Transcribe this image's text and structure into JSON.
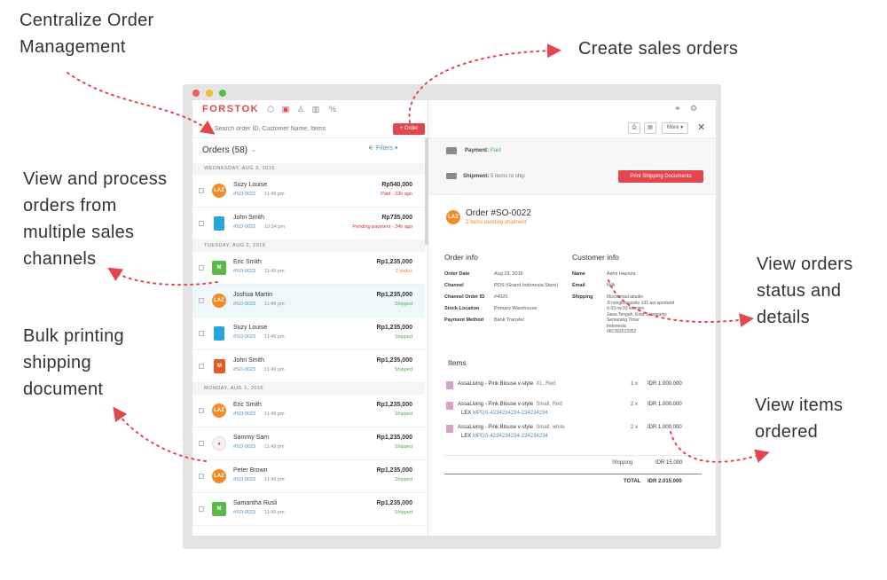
{
  "callouts": {
    "centralize": "Centralize Order\nManagement",
    "create": "Create sales orders",
    "view_process": "View and process\norders from\nmultiple sales\nchannels",
    "bulk": "Bulk printing\nshipping\ndocument",
    "status": "View orders\nstatus and\ndetails",
    "items": "View items\nordered"
  },
  "colors": {
    "accent": "#e0484e",
    "link": "#4a90c2",
    "paid": "#4caf50",
    "pending": "#d32f2f",
    "status_orange": "#f28a26"
  },
  "app": {
    "logo": "FORSTOK",
    "nav_icons": [
      "box-icon",
      "shopping-bag-icon",
      "user-icon",
      "bar-chart-icon",
      "discount-icon"
    ],
    "search_placeholder": "Search order ID, Customer Name, Items",
    "order_button": "+ Order",
    "orders_title": "Orders (58)",
    "filters": "Filters"
  },
  "groups": [
    {
      "date": "WEDNESDAY, AUG 3, 2016",
      "orders": [
        {
          "channel": "laz",
          "channel_label": "LAZ",
          "name": "Suzy Louise",
          "id": "#SO-0022",
          "time": "11:49 pm",
          "amount": "Rp540,000",
          "status": "Paid - 23h ago",
          "status_color": "#d32f2f"
        },
        {
          "channel": "bag",
          "channel_label": "",
          "name": "John Smith",
          "id": "#SO-0022",
          "time": "10:34 pm",
          "amount": "Rp735,000",
          "status": "Pending payment - 24h ago",
          "status_color": "#d32f2f"
        }
      ]
    },
    {
      "date": "TUESDAY, AUG 2, 2016",
      "orders": [
        {
          "channel": "multi",
          "channel_label": "M",
          "name": "Eric Smith",
          "id": "#SO-0023",
          "time": "11:49 pm",
          "amount": "Rp1,235,000",
          "status": "2 status",
          "status_color": "#f28a26"
        },
        {
          "channel": "laz",
          "channel_label": "LAZ",
          "name": "Joshua Martin",
          "id": "#SO-0023",
          "time": "11:49 pm",
          "amount": "Rp1,235,000",
          "status": "Shipped",
          "status_color": "#4caf50",
          "selected": true
        },
        {
          "channel": "bag",
          "channel_label": "",
          "name": "Suzy Louise",
          "id": "#SO-0023",
          "time": "11:49 pm",
          "amount": "Rp1,235,000",
          "status": "Shipped",
          "status_color": "#4caf50"
        },
        {
          "channel": "mag",
          "channel_label": "M",
          "name": "John Smith",
          "id": "#SO-0023",
          "time": "11:49 pm",
          "amount": "Rp1,235,000",
          "status": "Shipped",
          "status_color": "#4caf50"
        }
      ]
    },
    {
      "date": "MONDAY, AUG 1, 2016",
      "orders": [
        {
          "channel": "laz",
          "channel_label": "LAZ",
          "name": "Eric Smith",
          "id": "#SO-0023",
          "time": "11:49 pm",
          "amount": "Rp1,235,000",
          "status": "Shipped",
          "status_color": "#4caf50"
        },
        {
          "channel": "tok",
          "channel_label": "●",
          "name": "Sammy Sam",
          "id": "#SO-0023",
          "time": "11:49 pm",
          "amount": "Rp1,235,000",
          "status": "Shipped",
          "status_color": "#4caf50"
        },
        {
          "channel": "laz",
          "channel_label": "LAZ",
          "name": "Peter Brown",
          "id": "#SO-0023",
          "time": "11:49 pm",
          "amount": "Rp1,235,000",
          "status": "Shipped",
          "status_color": "#4caf50"
        },
        {
          "channel": "multi",
          "channel_label": "M",
          "name": "Samantha Rusli",
          "id": "#SO-0023",
          "time": "11:49 pm",
          "amount": "Rp1,235,000",
          "status": "Shipped",
          "status_color": "#4caf50"
        }
      ]
    }
  ],
  "detail": {
    "more": "More",
    "payment_label": "Payment:",
    "payment_value": "Paid",
    "shipment_label": "Shipment:",
    "shipment_value": "5 items to ship",
    "print_button": "Print Shipping Documents",
    "order_title": "Order #SO-0022",
    "order_sub": "2 items pending shipment",
    "order_info_title": "Order info",
    "customer_info_title": "Customer info",
    "order_info": [
      {
        "k": "Order Date",
        "v": "Aug 23, 2016"
      },
      {
        "k": "Channel",
        "v": "POS (Grand Indonesia Store)"
      },
      {
        "k": "Channel Order ID",
        "v": "#4020"
      },
      {
        "k": "Stock Location",
        "v": "Primary Warehouse"
      },
      {
        "k": "Payment Method",
        "v": "Bank Transfer"
      }
    ],
    "customer_info": {
      "name_k": "Name",
      "name_v": "Azmi Hayeza",
      "email_k": "Email",
      "email_v": "N/A",
      "shipping_k": "Shipping",
      "shipping_lines": [
        "Muchamad abudin",
        "Jl nongkowarsito 191 asr sportand",
        "rt 03 rw 03 kemijen",
        "Jawa Tengah, Kota Semarang-",
        "Semarang Timur",
        "Indonesia",
        "081391513352"
      ]
    },
    "items_title": "Items",
    "items": [
      {
        "name": "AssaLiving - Pink Blouse v-style",
        "variant": "XL, Red",
        "qty": "1 x",
        "price": "IDR 1.000.000",
        "sub_prefix": "",
        "sub_link": ""
      },
      {
        "name": "AssaLiving - Pink Blouse v-style",
        "variant": "Small, Red",
        "qty": "2 x",
        "price": "IDR 1.000.000",
        "sub_prefix": "LEX",
        "sub_link": "MPDS-4234234234-234234234"
      },
      {
        "name": "AssaLiving - Pink Blouse v-style",
        "variant": "Small, white",
        "qty": "2 x",
        "price": "IDR 1.000.000",
        "sub_prefix": "LEX",
        "sub_link": "MPDS-4234234234-234234234"
      }
    ],
    "shipping_label": "Shipping",
    "shipping_value": "IDR 15.000",
    "total_label": "TOTAL",
    "total_value": "IDR 2.015.000"
  }
}
